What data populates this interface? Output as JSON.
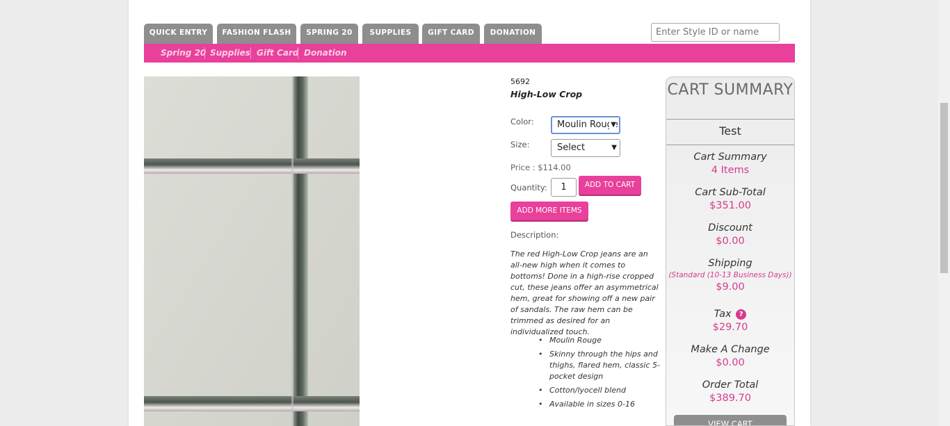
{
  "colors": {
    "accent": "#e8409b",
    "tab_gray": "#8e8e8e",
    "cart_value": "#d63a8e"
  },
  "tabs": [
    {
      "label": "QUICK ENTRY"
    },
    {
      "label": "FASHION FLASH"
    },
    {
      "label": "SPRING 20"
    },
    {
      "label": "SUPPLIES"
    },
    {
      "label": "GIFT CARD"
    },
    {
      "label": "DONATION"
    }
  ],
  "search": {
    "placeholder": "Enter Style ID or name"
  },
  "subnav": [
    {
      "label": "Spring 20"
    },
    {
      "label": "Supplies"
    },
    {
      "label": "Gift Card"
    },
    {
      "label": "Donation"
    }
  ],
  "product": {
    "style_id": "5692",
    "name": "High-Low Crop",
    "color_label": "Color:",
    "color_value": "Moulin Rouge",
    "size_label": "Size:",
    "size_value": "Select",
    "price_text": "Price : $114.00",
    "quantity_label": "Quantity:",
    "quantity_value": "1",
    "add_to_cart": "ADD TO CART",
    "add_more": "ADD MORE ITEMS",
    "description_label": "Description:",
    "description": "The red High-Low Crop jeans are an all-new high when it comes to bottoms! Done in a high-rise cropped cut, these jeans offer an asymmetrical hem, great for showing off a new pair of sandals. The raw hem can be trimmed as desired for an individualized touch.",
    "features": [
      "Moulin Rouge",
      "Skinny through the hips and thighs, flared hem, classic 5-pocket design",
      "Cotton/lyocell blend",
      "Available in sizes 0-16"
    ]
  },
  "cart": {
    "title": "CART SUMMARY",
    "user": "Test",
    "summary_label": "Cart Summary",
    "summary_value": "4 Items",
    "subtotal_label": "Cart Sub-Total",
    "subtotal_value": "$351.00",
    "discount_label": "Discount",
    "discount_value": "$0.00",
    "shipping_label": "Shipping",
    "shipping_method": "(Standard (10-13 Business Days))",
    "shipping_value": "$9.00",
    "tax_label": "Tax",
    "tax_help": "?",
    "tax_value": "$29.70",
    "change_label": "Make A Change",
    "change_value": "$0.00",
    "total_label": "Order Total",
    "total_value": "$389.70",
    "view_cart": "VIEW CART"
  }
}
